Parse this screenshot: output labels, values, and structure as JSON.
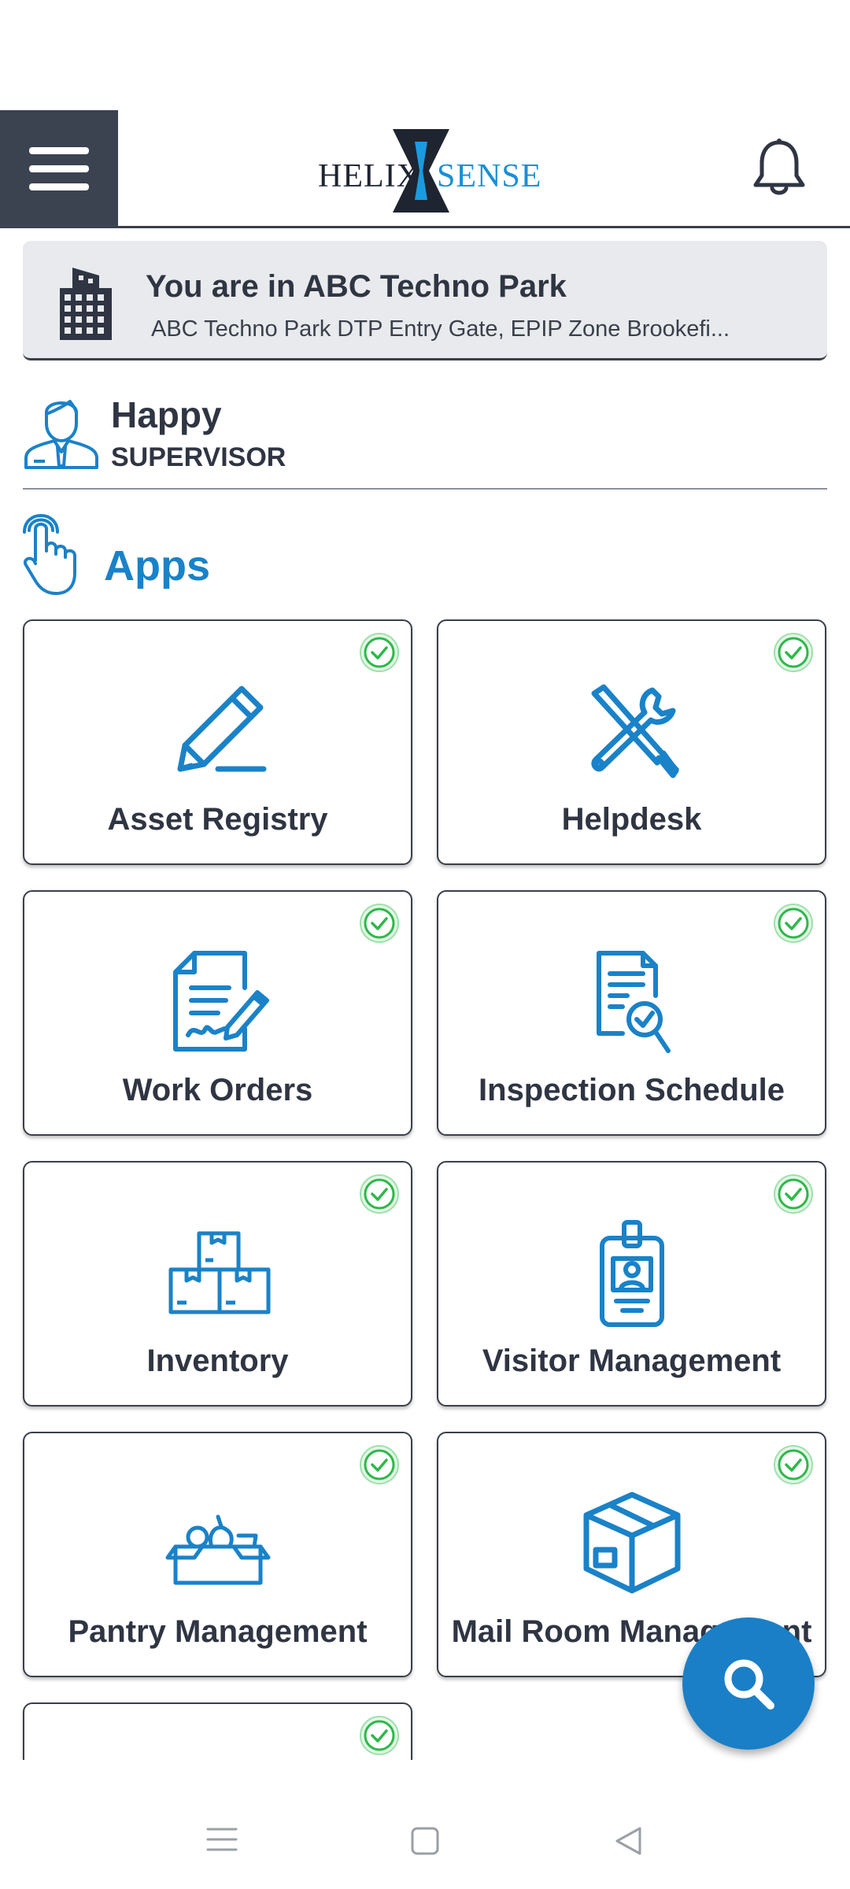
{
  "header": {
    "logo_left": "HELIX",
    "logo_right": "SENSE"
  },
  "location": {
    "title": "You are in ABC Techno Park",
    "subtitle": "ABC Techno Park DTP Entry Gate, EPIP Zone Brookefi..."
  },
  "user": {
    "name": "Happy",
    "role": "SUPERVISOR"
  },
  "apps": {
    "title": "Apps",
    "items": [
      {
        "label": "Asset Registry",
        "icon": "pencil-icon"
      },
      {
        "label": "Helpdesk",
        "icon": "tools-icon"
      },
      {
        "label": "Work Orders",
        "icon": "signed-document-icon"
      },
      {
        "label": "Inspection Schedule",
        "icon": "document-search-icon"
      },
      {
        "label": "Inventory",
        "icon": "boxes-icon"
      },
      {
        "label": "Visitor Management",
        "icon": "id-badge-icon"
      },
      {
        "label": "Pantry Management",
        "icon": "pantry-box-icon"
      },
      {
        "label": "Mail Room Management",
        "icon": "package-icon"
      },
      {
        "label": "",
        "icon": ""
      }
    ]
  },
  "colors": {
    "accent": "#1a82c8",
    "header_dark": "#3b4250",
    "check_green": "#2eb84a"
  }
}
